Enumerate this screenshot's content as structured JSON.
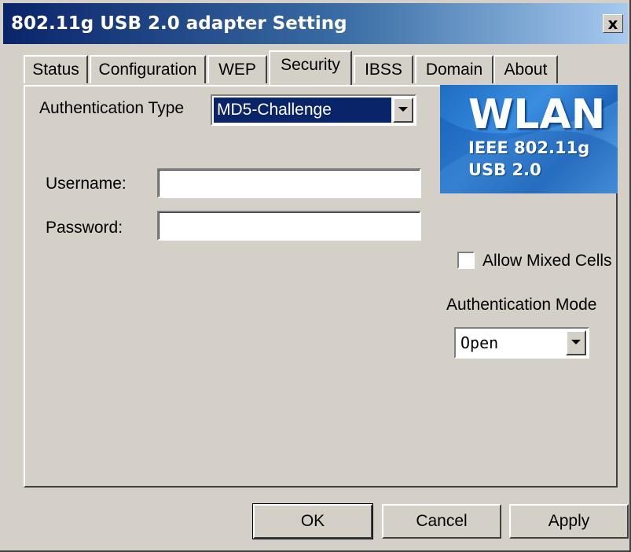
{
  "window": {
    "title": "802.11g USB 2.0 adapter Setting",
    "close_glyph": "x"
  },
  "tabs": [
    {
      "label": "Status"
    },
    {
      "label": "Configuration"
    },
    {
      "label": "WEP"
    },
    {
      "label": "Security",
      "active": true
    },
    {
      "label": "IBSS"
    },
    {
      "label": "Domain"
    },
    {
      "label": "About"
    }
  ],
  "security": {
    "auth_type_label": "Authentication Type",
    "auth_type_value": "MD5-Challenge",
    "username_label": "Username:",
    "username_value": "",
    "password_label": "Password:",
    "password_value": "",
    "allow_mixed_cells_label": "Allow Mixed Cells",
    "allow_mixed_cells_checked": false,
    "auth_mode_label": "Authentication Mode",
    "auth_mode_value": "Open"
  },
  "logo": {
    "brand": "WLAN",
    "line1": "IEEE 802.11g",
    "line2": "USB 2.0"
  },
  "buttons": {
    "ok": "OK",
    "cancel": "Cancel",
    "apply": "Apply"
  },
  "colors": {
    "title_start": "#0a246a",
    "title_end": "#a6caf0",
    "face": "#d4d0c8",
    "selection": "#0a246a"
  }
}
